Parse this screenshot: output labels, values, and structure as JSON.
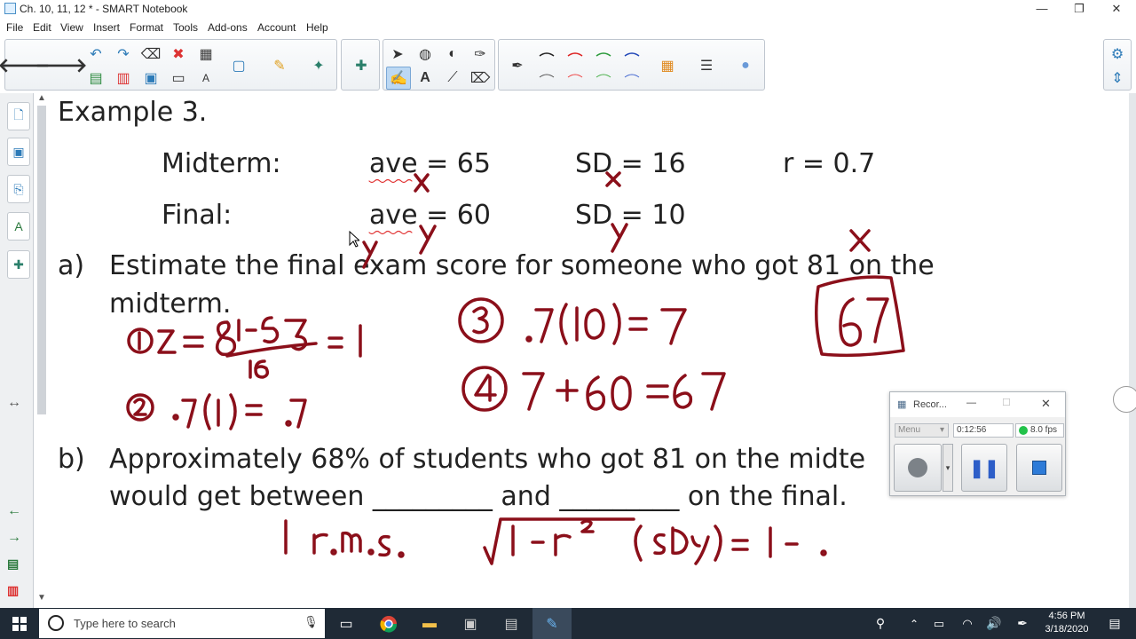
{
  "window": {
    "title": "Ch. 10, 11, 12 * - SMART Notebook"
  },
  "menu": [
    "File",
    "Edit",
    "View",
    "Insert",
    "Format",
    "Tools",
    "Add-ons",
    "Account",
    "Help"
  ],
  "slide": {
    "heading": "Example 3.",
    "row1": {
      "label": "Midterm:",
      "ave": "ave = 65",
      "sd": "SD = 16",
      "r": "r = 0.7"
    },
    "row2": {
      "label": "Final:",
      "ave": "ave = 60",
      "sd": "SD = 10"
    },
    "part_a": {
      "letter": "a)",
      "line1": "Estimate the final exam score for someone who got 81 on the",
      "line2": "midterm."
    },
    "part_b": {
      "letter": "b)",
      "line1": "Approximately 68% of students who got 81 on the midte",
      "line2": "would get between _________ and _________ on the final."
    }
  },
  "recorder": {
    "title": "Recor...",
    "menu_label": "Menu",
    "elapsed": "0:12:56",
    "fps": "8.0 fps",
    "status_color": "#22c24a"
  },
  "taskbar": {
    "search_placeholder": "Type here to search",
    "time": "4:56 PM",
    "date": "3/18/2020"
  },
  "colors": {
    "ink": "#8b0f1a",
    "accent": "#2d7bb8"
  }
}
